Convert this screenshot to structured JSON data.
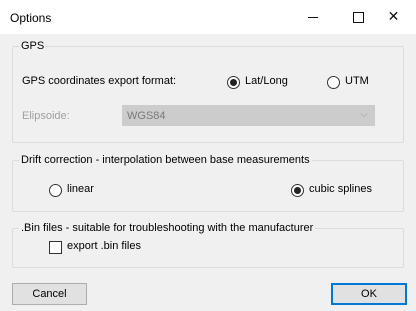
{
  "window": {
    "title": "Options"
  },
  "gps": {
    "group_label": "GPS",
    "format_label": "GPS coordinates export format:",
    "options": [
      {
        "label": "Lat/Long",
        "selected": true
      },
      {
        "label": "UTM",
        "selected": false
      }
    ],
    "ellipsoid_label": "Elipsoide:",
    "ellipsoid_value": "WGS84"
  },
  "drift": {
    "group_label": "Drift correction - interpolation between base measurements",
    "options": [
      {
        "label": "linear",
        "selected": false
      },
      {
        "label": "cubic splines",
        "selected": true
      }
    ]
  },
  "bin": {
    "group_label": ".Bin files - suitable for troubleshooting with the manufacturer",
    "checkbox_label": "export .bin files",
    "checked": false
  },
  "buttons": {
    "cancel": "Cancel",
    "ok": "OK"
  }
}
